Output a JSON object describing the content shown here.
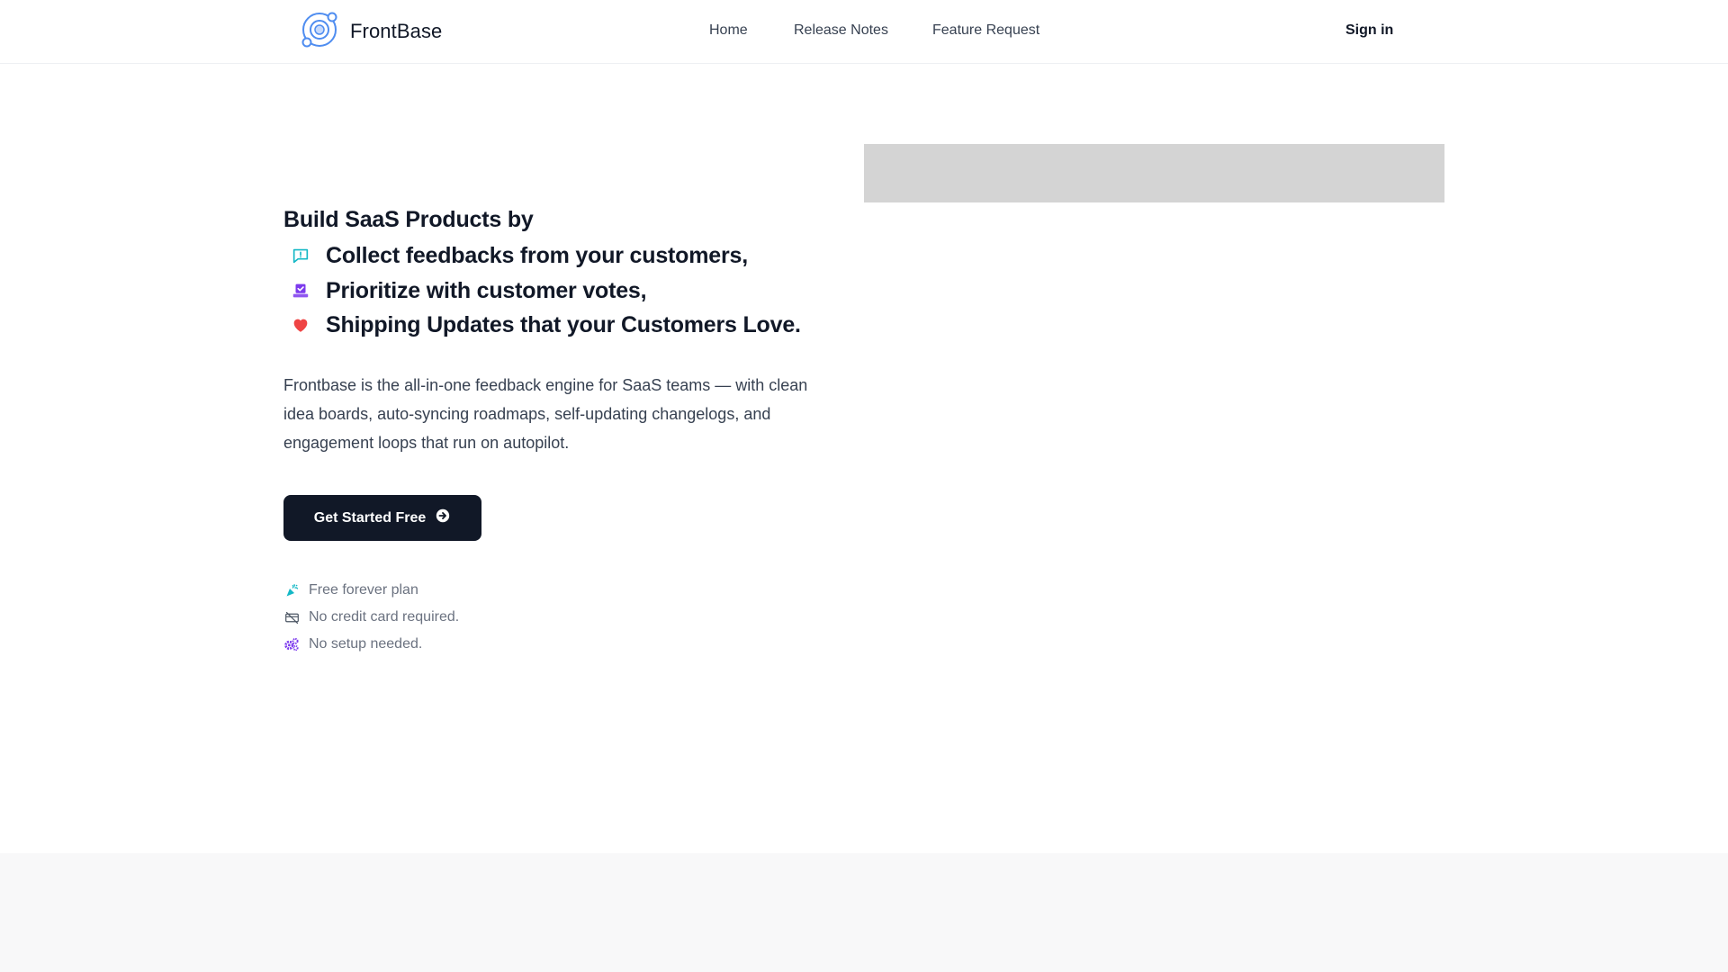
{
  "header": {
    "brand": "FrontBase",
    "nav": [
      "Home",
      "Release Notes",
      "Feature Request"
    ],
    "signin": "Sign in"
  },
  "hero": {
    "title": "Build SaaS Products by",
    "features": [
      {
        "icon": "message-alert-icon",
        "text": "Collect feedbacks from your customers,"
      },
      {
        "icon": "vote-box-icon",
        "text": "Prioritize with customer votes,"
      },
      {
        "icon": "heart-icon",
        "text": "Shipping Updates that your Customers Love."
      }
    ],
    "description": "Frontbase is the all-in-one feedback engine for SaaS teams — with clean idea boards, auto-syncing roadmaps, self-updating changelogs, and engagement loops that run on autopilot.",
    "cta": "Get Started Free",
    "perks": [
      {
        "icon": "party-popper-icon",
        "text": "Free forever plan"
      },
      {
        "icon": "no-credit-card-icon",
        "text": "No credit card required."
      },
      {
        "icon": "gears-icon",
        "text": "No setup needed."
      }
    ]
  },
  "colors": {
    "primary": "#111827",
    "teal": "#14b8c6",
    "purple": "#7c3aed",
    "red": "#ef4444",
    "placeholder": "#d4d4d4"
  }
}
